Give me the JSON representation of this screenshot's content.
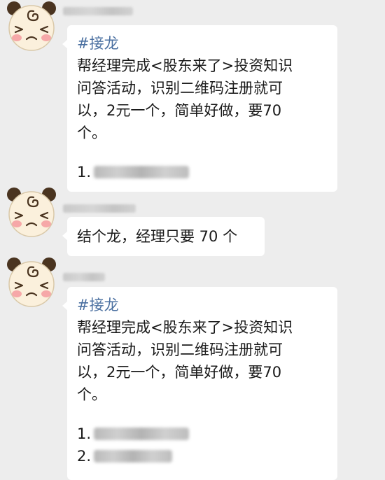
{
  "messages": [
    {
      "tag": "#接龙",
      "lines": [
        "帮经理完成<股东来了>投资知识",
        "问答活动，识别二维码注册就可",
        "以，2元一个，简单好做，要70",
        "个。"
      ],
      "list": [
        "1."
      ]
    },
    {
      "text": "结个龙，经理只要 70 个"
    },
    {
      "tag": "#接龙",
      "lines": [
        "帮经理完成<股东来了>投资知识",
        "问答活动，识别二维码注册就可",
        "以，2元一个，简单好做，要70",
        "个。"
      ],
      "list": [
        "1.",
        "2."
      ]
    }
  ],
  "colors": {
    "background": "#ededed",
    "bubble": "#ffffff",
    "tag": "#4a6fa0",
    "avatar_face": "#fbf0dc",
    "avatar_ears": "#4a3420",
    "avatar_cheeks": "#f6a8a8"
  },
  "icons": [
    "panda-avatar-icon"
  ]
}
